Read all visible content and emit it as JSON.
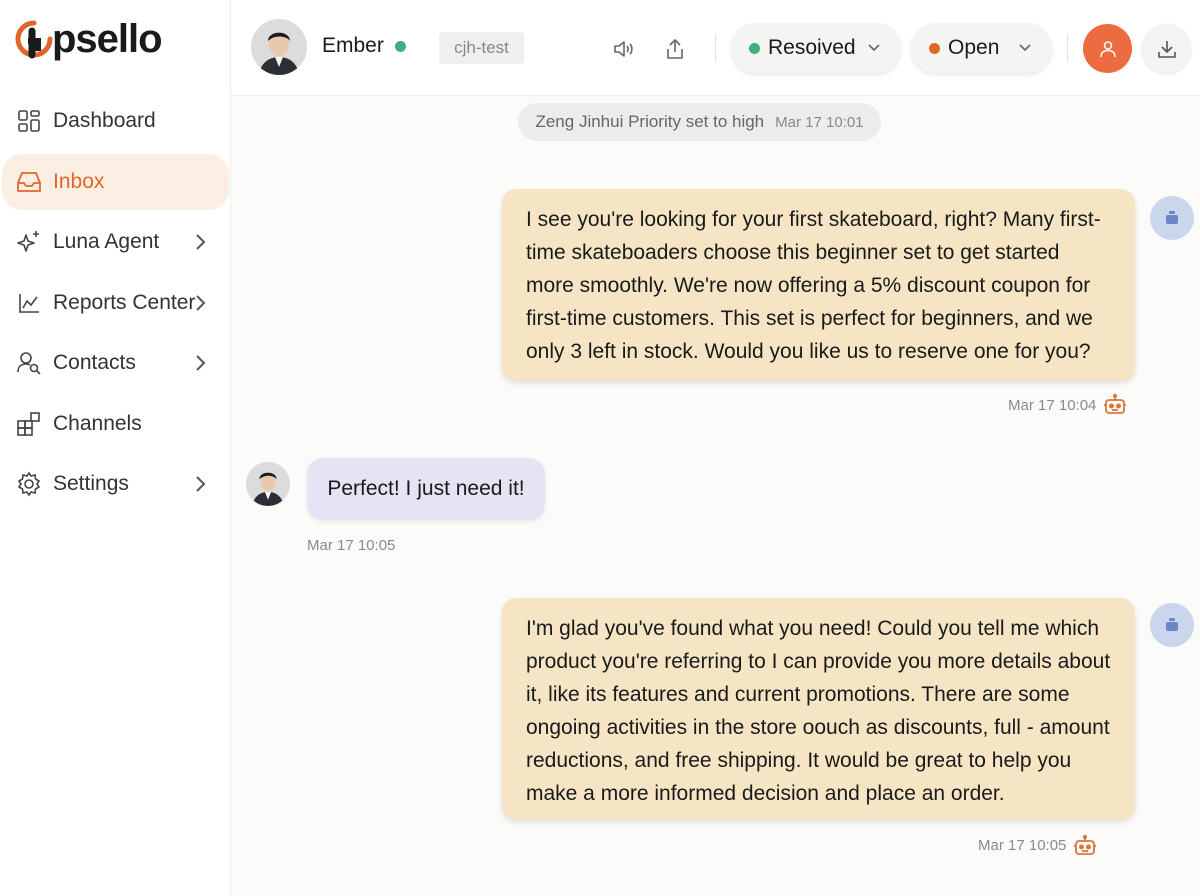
{
  "app": {
    "logo_text": "psello"
  },
  "colors": {
    "accent": "#e2662a",
    "online": "#3fb07a",
    "resolved": "#3fb07a",
    "open": "#e2662a",
    "bot_bubble": "#f6e5c4",
    "customer_bubble": "#e7e3f4"
  },
  "sidebar": {
    "items": [
      {
        "label": "Dashboard",
        "icon": "dashboard-icon"
      },
      {
        "label": "Inbox",
        "icon": "inbox-icon",
        "active": true
      },
      {
        "label": "Luna Agent",
        "icon": "sparkle-icon",
        "has_submenu": true
      },
      {
        "label": "Reports Center",
        "icon": "chart-icon",
        "has_submenu": true
      },
      {
        "label": "Contacts",
        "icon": "contacts-icon",
        "has_submenu": true
      },
      {
        "label": "Channels",
        "icon": "channels-icon"
      },
      {
        "label": "Settings",
        "icon": "gear-icon",
        "has_submenu": true
      }
    ]
  },
  "header": {
    "contact_name": "Ember",
    "tag": "cjh-test",
    "status_resolved": "Resoived",
    "status_open": "Open"
  },
  "chat": {
    "system_note": {
      "text": "Zeng Jinhui Priority set to high",
      "time": "Mar 17 10:01"
    },
    "messages": [
      {
        "from": "bot",
        "text": "I see you're looking for your first skateboard, right? Many first-time skateboaders choose this beginner set to get started more smoothly. We're now offering a 5% discount coupon for first-time  customers. This set is perfect for beginners, and we only  3 left in stock. Would you like us to reserve one for you?",
        "time": "Mar 17 10:04"
      },
      {
        "from": "customer",
        "text": "Perfect! I just need it!",
        "time": "Mar 17 10:05"
      },
      {
        "from": "bot",
        "text": "I'm glad you've found what you need! Could you tell me which product you're referring to I can provide you more details about it, like its features and current promotions. There are some ongoing activities in the store oouch as discounts, full - amount reductions, and free shipping. It would be great to help you make a more informed decision and place an order.",
        "time": "Mar 17 10:05"
      }
    ]
  }
}
